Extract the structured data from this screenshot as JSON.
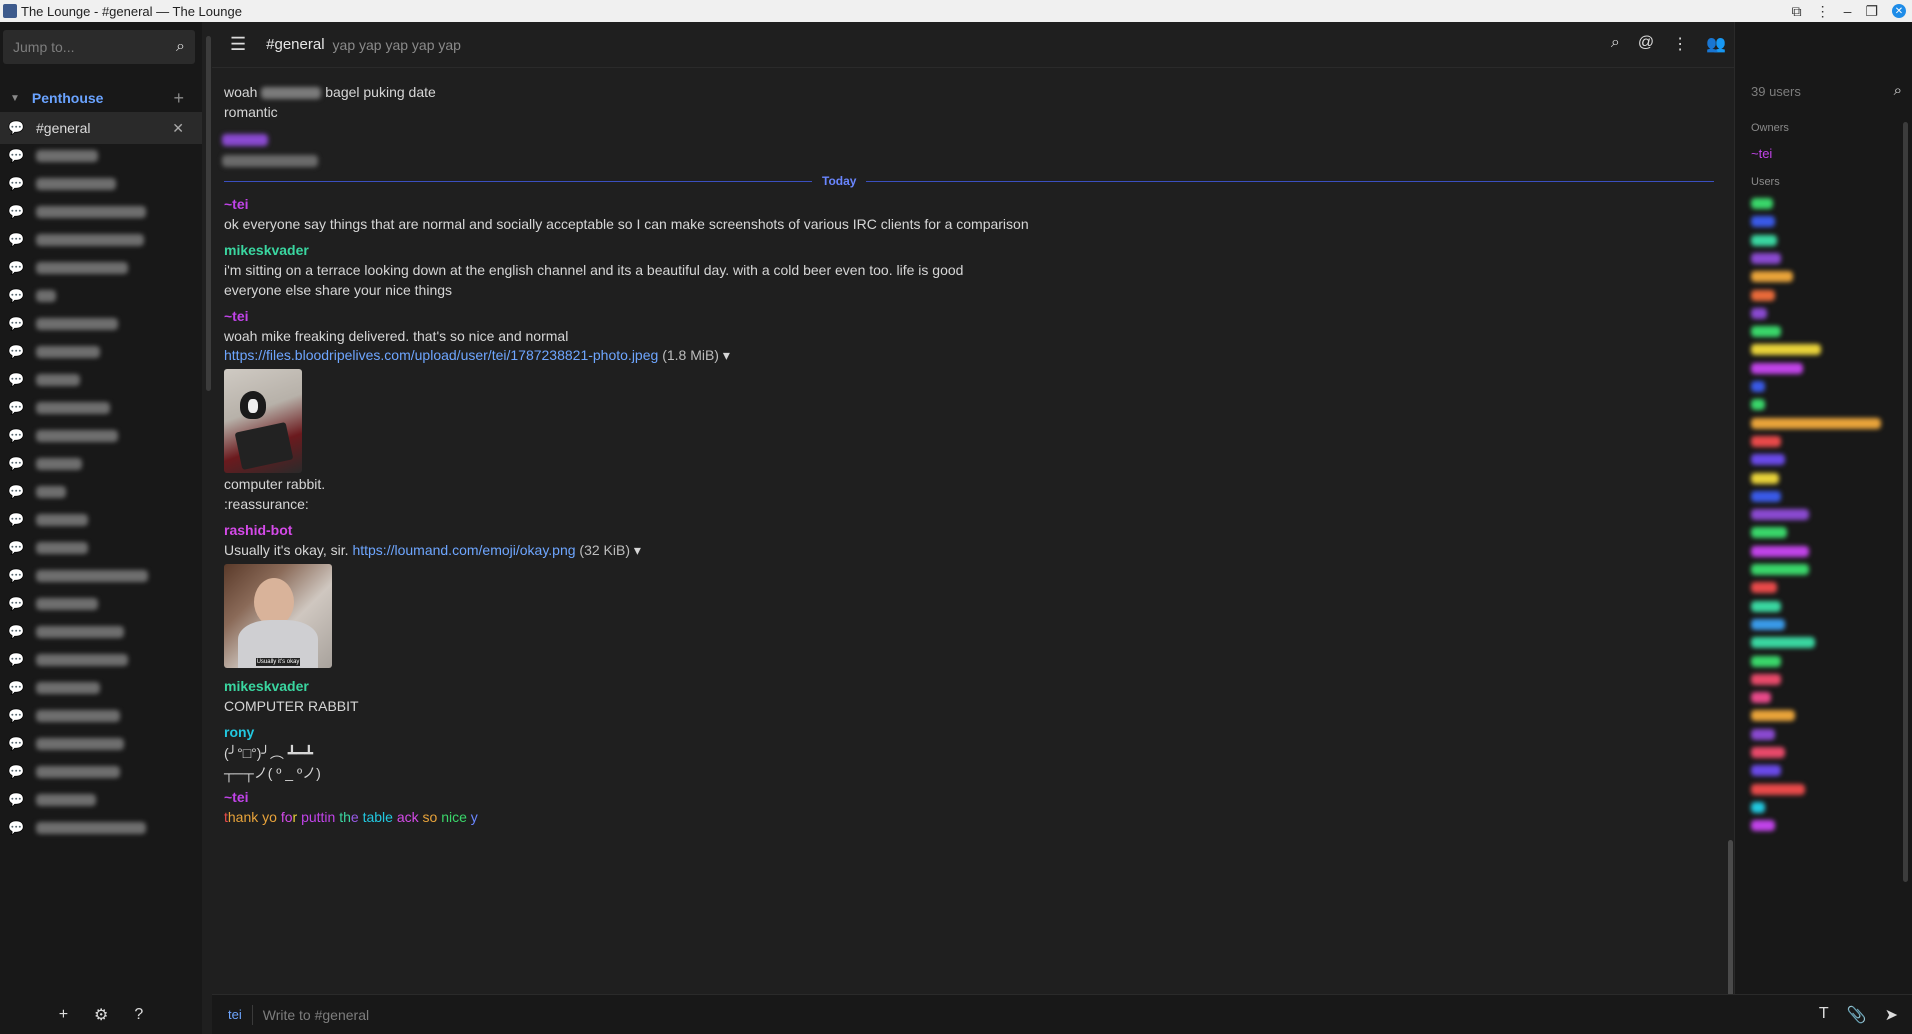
{
  "window": {
    "title": "The Lounge - #general — The Lounge"
  },
  "sidebar": {
    "jump_placeholder": "Jump to...",
    "network": "Penthouse",
    "active_channel": "#general"
  },
  "topbar": {
    "channel": "#general",
    "topic": "yap yap yap yap yap"
  },
  "messages": {
    "old1_prefix": "woah",
    "old1_suffix": "bagel puking date",
    "old2": "romantic",
    "divider": "Today",
    "m1_nick": "~tei",
    "m1_text": "ok everyone say things that are normal and socially acceptable so I can make screenshots of various IRC clients for a comparison",
    "m2_nick": "mikeskvader",
    "m2_text1": "i'm sitting on a terrace looking down at the english channel and its a beautiful day. with a cold beer even too. life is good",
    "m2_text2": "everyone else share your nice things",
    "m3_nick": "~tei",
    "m3_text1": "woah mike freaking delivered. that's so nice and normal",
    "m3_link": "https://files.bloodripelives.com/upload/user/tei/1787238821-photo.jpeg",
    "m3_size": "(1.8 MiB)",
    "m3_text2": "computer rabbit.",
    "m3_text3": ":reassurance:",
    "m4_nick": "rashid-bot",
    "m4_text": "Usually it's okay, sir.",
    "m4_link": "https://loumand.com/emoji/okay.png",
    "m4_size": "(32 KiB)",
    "m4_caption": "Usually it's okay",
    "m5_nick": "mikeskvader",
    "m5_text": "COMPUTER RABBIT",
    "m6_nick": "rony",
    "m6_text1": "(╯°□°)╯︵ ┻━┻",
    "m6_text2": "┬─┬ノ( º _ ºノ)",
    "m7_nick": "~tei",
    "m7_rainbow": [
      "t",
      "hank yo",
      " fo",
      "r",
      " puttin",
      " th",
      "e",
      " table",
      " ack",
      " so",
      " nice",
      " y"
    ]
  },
  "userlist": {
    "count": "39 users",
    "owners_label": "Owners",
    "owner": "~tei",
    "users_label": "Users"
  },
  "input": {
    "nick": "tei",
    "placeholder": "Write to #general"
  },
  "colors": {
    "accent": "#6a86ff",
    "link": "#6ea6ff",
    "nick_tei": "#c043e8",
    "nick_mike": "#3ad6a0",
    "nick_rashid": "#d44ae8",
    "nick_rony": "#22c8e0",
    "rainbow": [
      "#e84a4a",
      "#e8a33a",
      "#d44ae8",
      "#e8d23a",
      "#c043e8",
      "#3ad6a0",
      "#9a5ae8",
      "#22c8e0",
      "#d44ae8",
      "#e8a33a",
      "#3ad66a",
      "#6a86ff"
    ]
  }
}
